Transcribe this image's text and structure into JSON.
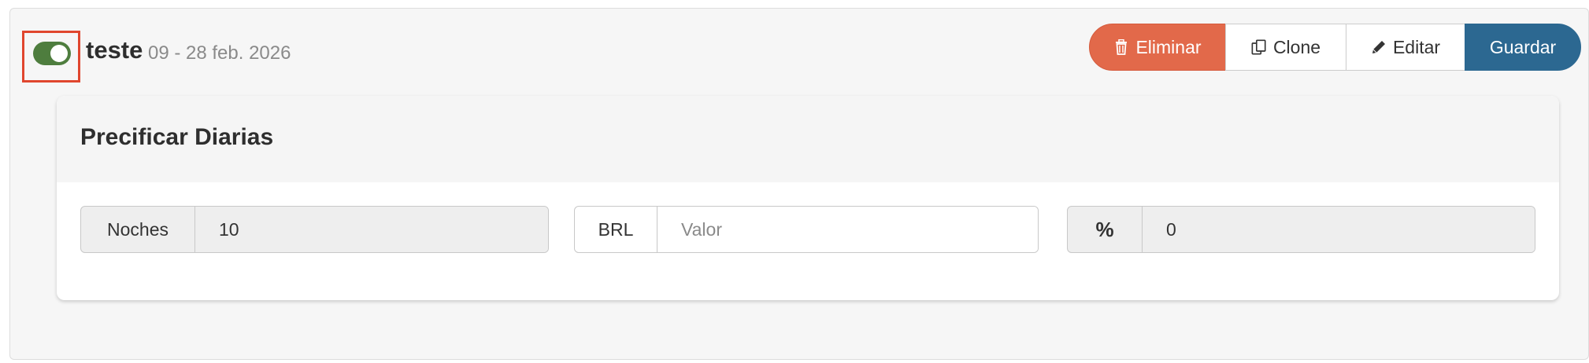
{
  "header": {
    "title": "teste",
    "dates": "09 - 28 feb. 2026",
    "toggle_on": true
  },
  "actions": {
    "eliminar_label": "Eliminar",
    "clone_label": "Clone",
    "editar_label": "Editar",
    "guardar_label": "Guardar"
  },
  "icons": {
    "eliminar": "trash-icon",
    "clone": "copy-icon",
    "editar": "pencil-icon"
  },
  "card": {
    "title": "Precificar Diarias",
    "noches": {
      "label": "Noches",
      "value": "10"
    },
    "brl": {
      "label": "BRL",
      "value": "",
      "placeholder": "Valor"
    },
    "percent": {
      "label": "%",
      "value": "0"
    }
  },
  "colors": {
    "danger": "#e2694a",
    "primary": "#2c6891",
    "toggle_on": "#4e7d3e",
    "highlight": "#e0462e"
  }
}
